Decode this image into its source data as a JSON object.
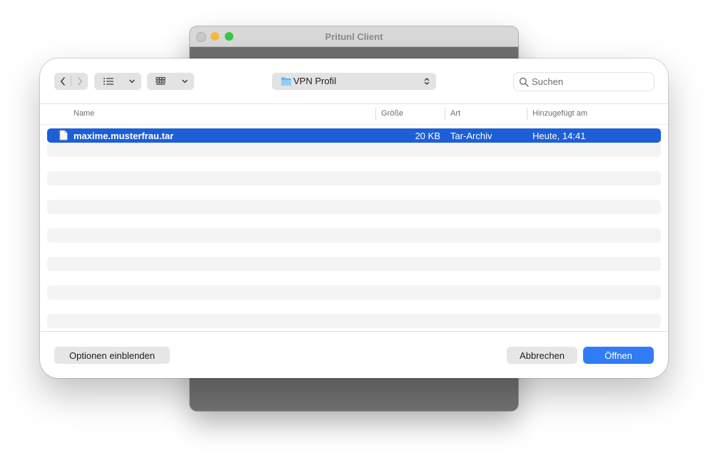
{
  "background_window": {
    "title": "Pritunl Client"
  },
  "dialog": {
    "path": {
      "folder_label": "VPN Profil",
      "folder_icon": "folder-icon"
    },
    "search": {
      "placeholder": "Suchen",
      "value": ""
    },
    "columns": {
      "name": "Name",
      "size": "Größe",
      "kind": "Art",
      "added": "Hinzugefügt am"
    },
    "files": [
      {
        "name": "maxime.musterfrau.tar",
        "size": "20 KB",
        "kind": "Tar-Archiv",
        "added": "Heute, 14:41",
        "selected": true
      }
    ],
    "buttons": {
      "options": "Optionen einblenden",
      "cancel": "Abbrechen",
      "open": "Öffnen"
    }
  },
  "colors": {
    "selection": "#1d5fd6",
    "primary_button": "#2f7cf6",
    "traffic_close_inactive": "#c9c9c9",
    "traffic_minimize": "#f6b73c",
    "traffic_maximize": "#35c649"
  }
}
